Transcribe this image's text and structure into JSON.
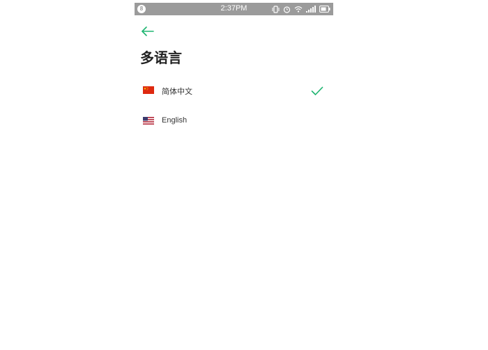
{
  "status_bar": {
    "badge": "8",
    "time": "2:37PM"
  },
  "header": {
    "back_icon": "arrow-left-icon",
    "title": "多语言"
  },
  "languages": [
    {
      "label": "简体中文",
      "flag_icon": "china-flag-icon",
      "selected": true
    },
    {
      "label": "English",
      "flag_icon": "us-flag-icon",
      "selected": false
    }
  ],
  "colors": {
    "accent": "#1fb571",
    "status_bar": "#9b9b9b",
    "title": "#222222"
  }
}
